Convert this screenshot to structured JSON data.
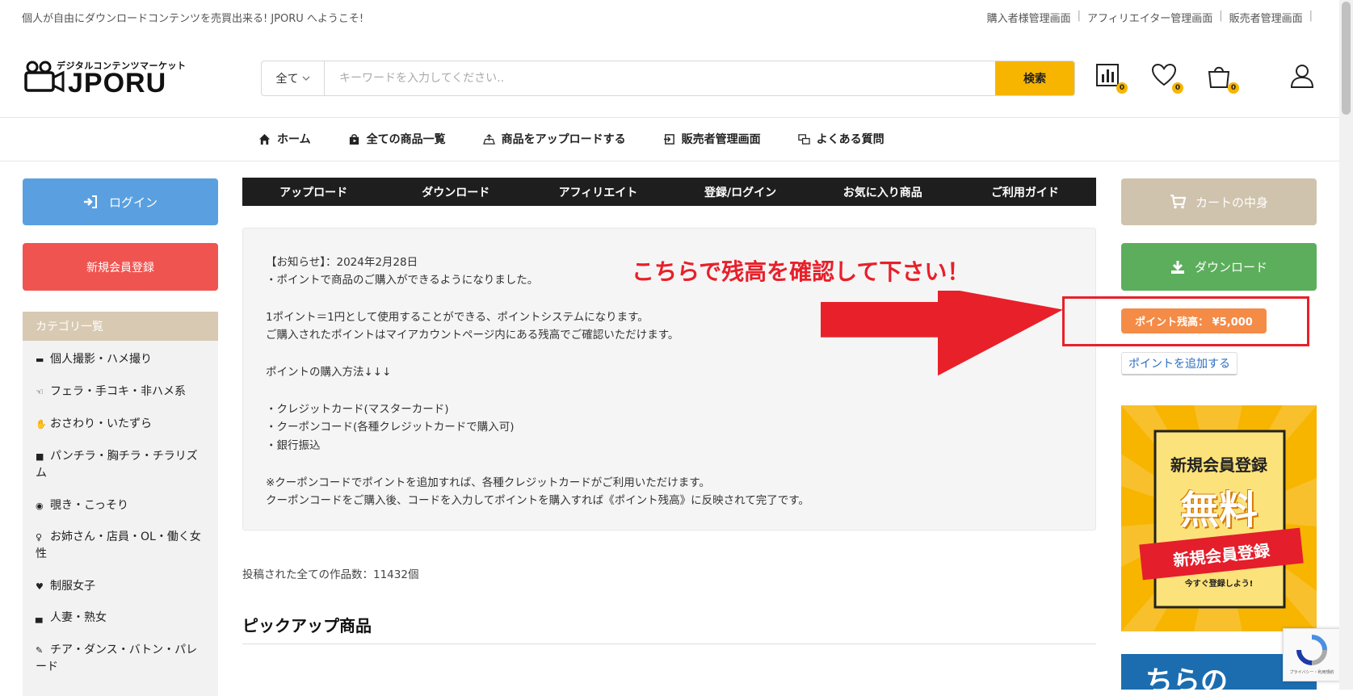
{
  "topbar": {
    "welcome": "個人が自由にダウンロードコンテンツを売買出来る! JPORU へようこそ!",
    "links": [
      "購入者様管理画面",
      "アフィリエイター管理画面",
      "販売者管理画面"
    ],
    "sep": "|"
  },
  "logo": {
    "sub": "デジタルコンテンツマーケット",
    "name": "JPORU"
  },
  "search": {
    "category": "全て",
    "placeholder": "キーワードを入力してください..",
    "button": "検索"
  },
  "header_icons": [
    {
      "icon": "ranking-icon",
      "count": "0"
    },
    {
      "icon": "heart-icon",
      "count": "0"
    },
    {
      "icon": "bag-icon",
      "count": "0"
    },
    {
      "icon": "user-icon"
    }
  ],
  "nav": [
    "ホーム",
    "全ての商品一覧",
    "商品をアップロードする",
    "販売者管理画面",
    "よくある質問"
  ],
  "left": {
    "login": "ログイン",
    "register": "新規会員登録",
    "category_title": "カテゴリ一覧",
    "categories": [
      "個人撮影・ハメ撮り",
      "フェラ・手コキ・非ハメ系",
      "おさわり・いたずら",
      "パンチラ・胸チラ・チラリズム",
      "覗き・こっそり",
      "お姉さん・店員・OL・働く女性",
      "制服女子",
      "人妻・熟女",
      "チア・ダンス・バトン・パレード"
    ]
  },
  "tabs": [
    "アップロード",
    "ダウンロード",
    "アフィリエイト",
    "登録/ログイン",
    "お気に入り商品",
    "ご利用ガイド"
  ],
  "notice": {
    "lines": [
      "【お知らせ】：2024年2月28日",
      "・ポイントで商品のご購入ができるようになりました。",
      "",
      "1ポイント＝1円として使用することができる、ポイントシステムになります。",
      "ご購入されたポイントはマイアカウントページ内にある残高でご確認いただけます。",
      "",
      "ポイントの購入方法↓↓↓",
      "",
      "・クレジットカード(マスターカード)",
      "・クーポンコード(各種クレジットカードで購入可)",
      "・銀行振込",
      "",
      "※クーポンコードでポイントを追加すれば、各種クレジットカードがご利用いただけます。",
      "クーポンコードをご購入後、コードを入力してポイントを購入すれば《ポイント残高》に反映されて完了です。"
    ]
  },
  "annotation": {
    "text": "こちらで残高を確認して下さい！",
    "color": "#e8202a"
  },
  "count_text": "投稿された全ての作品数：11432個",
  "pickup_title": "ピックアップ商品",
  "right": {
    "cart": "カートの中身",
    "download": "ダウンロード",
    "points": "ポイント残高： ¥5,000",
    "add_points": "ポイントを追加する",
    "banner": {
      "title": "新規会員登録",
      "big": "無料",
      "ribbon": "新規会員登録",
      "cta": "今すぐ登録しよう!"
    },
    "banner2_text": "ちらの"
  },
  "recaptcha_text": "プライバシー・利用規約",
  "colors": {
    "accent": "#f7b500",
    "login": "#5aa0e0",
    "register": "#f05450",
    "download": "#5cae5c",
    "points": "#f48b46"
  }
}
